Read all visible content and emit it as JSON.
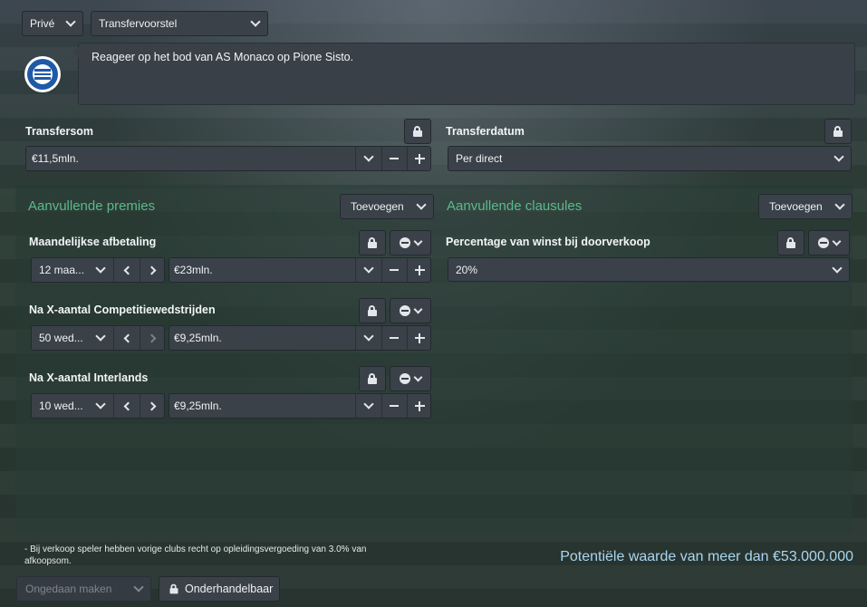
{
  "header": {
    "privacy_select": "Privé",
    "type_select": "Transfervoorstel"
  },
  "message": {
    "text": "Reageer op het bod van AS Monaco op Pione Sisto.",
    "club_logo": "hertha-bsc-crest"
  },
  "transfersom": {
    "label": "Transfersom",
    "value": "€11,5mln."
  },
  "transferdatum": {
    "label": "Transferdatum",
    "value": "Per direct"
  },
  "premies": {
    "title": "Aanvullende premies",
    "add_label": "Toevoegen",
    "items": [
      {
        "label": "Maandelijkse afbetaling",
        "count": "12 maa...",
        "amount": "€23mln."
      },
      {
        "label": "Na X-aantal Competitiewedstrijden",
        "count": "50 wed...",
        "amount": "€9,25mln."
      },
      {
        "label": "Na X-aantal Interlands",
        "count": "10 wed...",
        "amount": "€9,25mln."
      }
    ]
  },
  "clausules": {
    "title": "Aanvullende clausules",
    "add_label": "Toevoegen",
    "items": [
      {
        "label": "Percentage van winst bij doorverkoop",
        "value": "20%"
      }
    ]
  },
  "footer": {
    "note": "- Bij verkoop speler hebben vorige clubs recht op opleidingsvergoeding van 3.0% van afkoopsom.",
    "potential_value": "Potentiële waarde van meer dan €53.000.000",
    "undo_label": "Ongedaan maken",
    "non_negotiable_label": "Onderhandelbaar"
  },
  "colors": {
    "accent_green": "#5cb98a",
    "control_bg": "#3a4149"
  }
}
